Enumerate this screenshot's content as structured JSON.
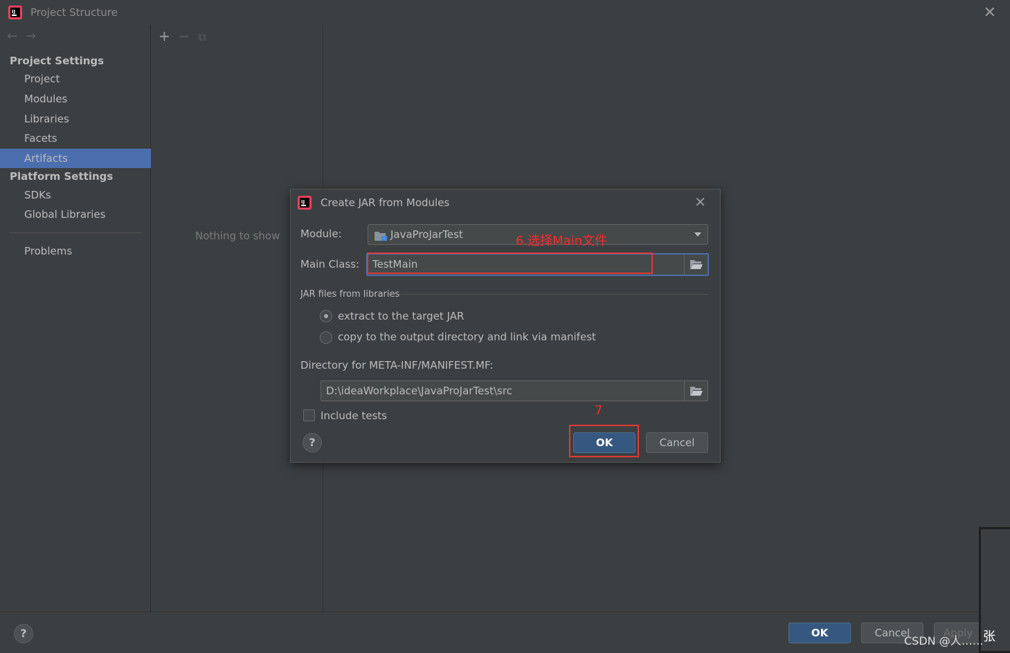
{
  "window": {
    "title": "Project Structure",
    "close_symbol": "✕",
    "nav": {
      "back": "←",
      "forward": "→"
    }
  },
  "sidebar": {
    "project_settings_header": "Project Settings",
    "project_items": [
      "Project",
      "Modules",
      "Libraries",
      "Facets",
      "Artifacts"
    ],
    "selected_item": "Artifacts",
    "platform_settings_header": "Platform Settings",
    "platform_items": [
      "SDKs",
      "Global Libraries"
    ],
    "problems_label": "Problems"
  },
  "middle_panel": {
    "toolbar": {
      "add": "+",
      "remove": "−",
      "copy": "⧉"
    },
    "empty_text": "Nothing to show"
  },
  "footer": {
    "help": "?",
    "ok_label": "OK",
    "cancel_label": "Cancel",
    "apply_label": "Apply",
    "watermark": "CSDN @人……",
    "corner_text": "张"
  },
  "dialog": {
    "title": "Create JAR from Modules",
    "close_symbol": "✕",
    "module_label": "Module:",
    "module_value": "JavaProJarTest",
    "main_class_label": "Main Class:",
    "main_class_value": "TestMain",
    "jar_group_label": "JAR files from libraries",
    "radio_extract": "extract to the target JAR",
    "radio_copy": "copy to the output directory and link via manifest",
    "radio_selected": "extract",
    "manifest_dir_label": "Directory for META-INF/MANIFEST.MF:",
    "manifest_dir_value": "D:\\ideaWorkplace\\JavaProJarTest\\src",
    "include_tests_label": "Include tests",
    "include_tests_checked": false,
    "help": "?",
    "ok_label": "OK",
    "cancel_label": "Cancel"
  },
  "annotations": {
    "step6": "6.选择Main文件",
    "step7": "7",
    "color": "#e53935"
  },
  "colors": {
    "background": "#3c3f41",
    "selection": "#4b6eaf",
    "primary_button": "#365880"
  }
}
